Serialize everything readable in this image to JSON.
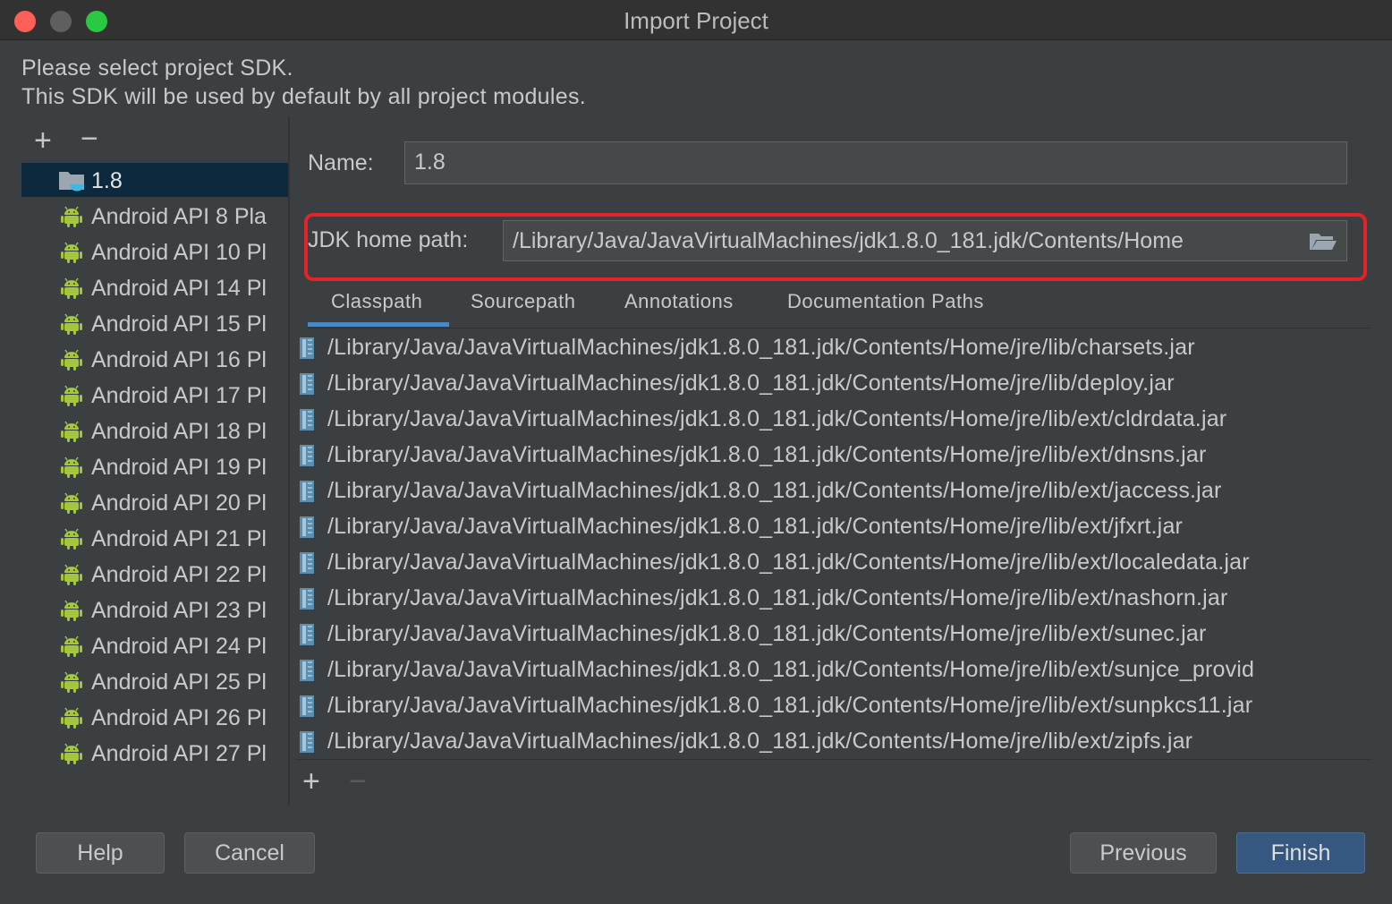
{
  "window": {
    "title": "Import Project"
  },
  "intro": {
    "line1": "Please select project SDK.",
    "line2": "This SDK will be used by default by all project modules."
  },
  "sdk_toolbar": {
    "add": "+",
    "remove": "−"
  },
  "sdk_list": [
    {
      "label": "1.8",
      "icon": "jdk-folder-icon",
      "selected": true
    },
    {
      "label": "Android API 8 Pla",
      "icon": "android-icon"
    },
    {
      "label": "Android API 10 Pl",
      "icon": "android-icon"
    },
    {
      "label": "Android API 14 Pl",
      "icon": "android-icon"
    },
    {
      "label": "Android API 15 Pl",
      "icon": "android-icon"
    },
    {
      "label": "Android API 16 Pl",
      "icon": "android-icon"
    },
    {
      "label": "Android API 17 Pl",
      "icon": "android-icon"
    },
    {
      "label": "Android API 18 Pl",
      "icon": "android-icon"
    },
    {
      "label": "Android API 19 Pl",
      "icon": "android-icon"
    },
    {
      "label": "Android API 20 Pl",
      "icon": "android-icon"
    },
    {
      "label": "Android API 21 Pl",
      "icon": "android-icon"
    },
    {
      "label": "Android API 22 Pl",
      "icon": "android-icon"
    },
    {
      "label": "Android API 23 Pl",
      "icon": "android-icon"
    },
    {
      "label": "Android API 24 Pl",
      "icon": "android-icon"
    },
    {
      "label": "Android API 25 Pl",
      "icon": "android-icon"
    },
    {
      "label": "Android API 26 Pl",
      "icon": "android-icon"
    },
    {
      "label": "Android API 27 Pl",
      "icon": "android-icon"
    }
  ],
  "sdk_form": {
    "name_label": "Name:",
    "name_value": "1.8",
    "home_label": "JDK home path:",
    "home_value": "/Library/Java/JavaVirtualMachines/jdk1.8.0_181.jdk/Contents/Home"
  },
  "tabs": [
    {
      "label": "Classpath",
      "active": true
    },
    {
      "label": "Sourcepath"
    },
    {
      "label": "Annotations"
    },
    {
      "label": "Documentation Paths"
    }
  ],
  "classpath": [
    "/Library/Java/JavaVirtualMachines/jdk1.8.0_181.jdk/Contents/Home/jre/lib/charsets.jar",
    "/Library/Java/JavaVirtualMachines/jdk1.8.0_181.jdk/Contents/Home/jre/lib/deploy.jar",
    "/Library/Java/JavaVirtualMachines/jdk1.8.0_181.jdk/Contents/Home/jre/lib/ext/cldrdata.jar",
    "/Library/Java/JavaVirtualMachines/jdk1.8.0_181.jdk/Contents/Home/jre/lib/ext/dnsns.jar",
    "/Library/Java/JavaVirtualMachines/jdk1.8.0_181.jdk/Contents/Home/jre/lib/ext/jaccess.jar",
    "/Library/Java/JavaVirtualMachines/jdk1.8.0_181.jdk/Contents/Home/jre/lib/ext/jfxrt.jar",
    "/Library/Java/JavaVirtualMachines/jdk1.8.0_181.jdk/Contents/Home/jre/lib/ext/localedata.jar",
    "/Library/Java/JavaVirtualMachines/jdk1.8.0_181.jdk/Contents/Home/jre/lib/ext/nashorn.jar",
    "/Library/Java/JavaVirtualMachines/jdk1.8.0_181.jdk/Contents/Home/jre/lib/ext/sunec.jar",
    "/Library/Java/JavaVirtualMachines/jdk1.8.0_181.jdk/Contents/Home/jre/lib/ext/sunjce_provid",
    "/Library/Java/JavaVirtualMachines/jdk1.8.0_181.jdk/Contents/Home/jre/lib/ext/sunpkcs11.jar",
    "/Library/Java/JavaVirtualMachines/jdk1.8.0_181.jdk/Contents/Home/jre/lib/ext/zipfs.jar"
  ],
  "path_toolbar": {
    "add": "+",
    "remove": "−"
  },
  "buttons": {
    "help": "Help",
    "cancel": "Cancel",
    "previous": "Previous",
    "finish": "Finish"
  },
  "colors": {
    "background": "#3c3f41",
    "selection": "#0d293e",
    "highlight_border": "#e3222a",
    "accent": "#4a88c7",
    "primary_button": "#365880",
    "android_green": "#a4c639",
    "close": "#fe5f57",
    "minimize": "#5f5f5f",
    "zoom": "#28c840"
  }
}
